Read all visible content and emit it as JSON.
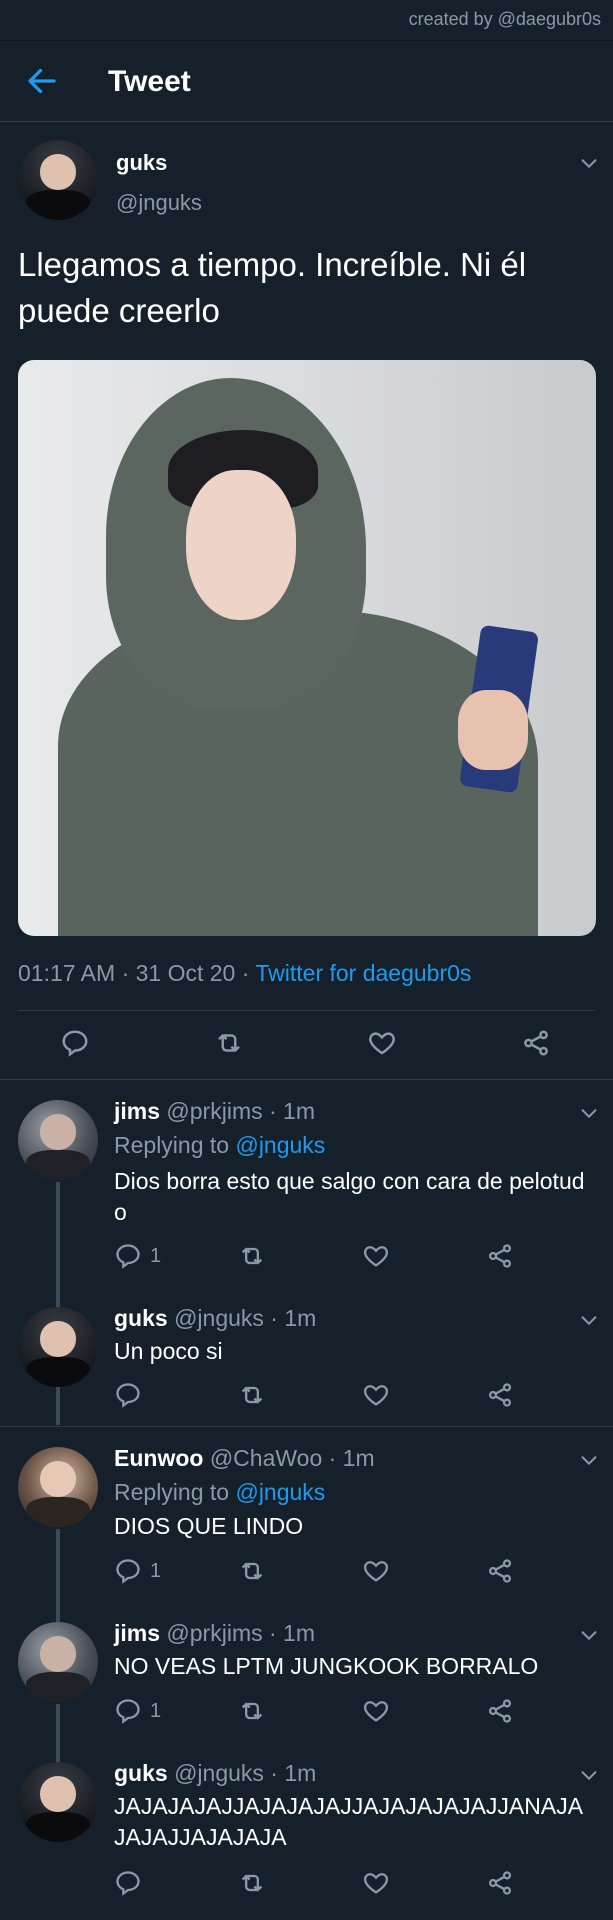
{
  "watermark": "created by @daegubr0s",
  "header": {
    "title": "Tweet"
  },
  "main_tweet": {
    "name": "guks",
    "handle": "@jnguks",
    "text": "Llegamos a tiempo. Increíble. Ni él puede creerlo",
    "time": "01:17 AM · 31 Oct 20 · ",
    "source": "Twitter for daegubr0s"
  },
  "replies": [
    {
      "name": "jims",
      "meta": " @prkjims · 1m",
      "replying_prefix": "Replying to ",
      "replying_to": "@jnguks",
      "text": "Dios borra esto que salgo con cara de pelotudo",
      "reply_count": "1"
    },
    {
      "name": "guks",
      "meta": " @jnguks · 1m",
      "text": "Un poco si",
      "reply_count": ""
    },
    {
      "name": "Eunwoo",
      "meta": " @ChaWoo · 1m",
      "replying_prefix": "Replying to ",
      "replying_to": "@jnguks",
      "text": "DIOS QUE LINDO",
      "reply_count": "1"
    },
    {
      "name": "jims",
      "meta": " @prkjims · 1m",
      "text": "NO VEAS LPTM JUNGKOOK BORRALO",
      "reply_count": "1"
    },
    {
      "name": "guks",
      "meta": " @jnguks · 1m",
      "text": "JAJAJAJAJJAJAJAJAJJAJAJAJAJAJJANAJAJAJAJJAJAJAJA",
      "reply_count": ""
    }
  ],
  "icons": {
    "back": "arrow-left-icon",
    "reply": "reply-icon",
    "retweet": "retweet-icon",
    "like": "heart-icon",
    "share": "share-icon",
    "more": "chevron-down-icon"
  },
  "colors": {
    "background": "#15202b",
    "accent": "#1d9bf0",
    "secondary_text": "#8b98a5",
    "divider": "#2f3b47"
  }
}
